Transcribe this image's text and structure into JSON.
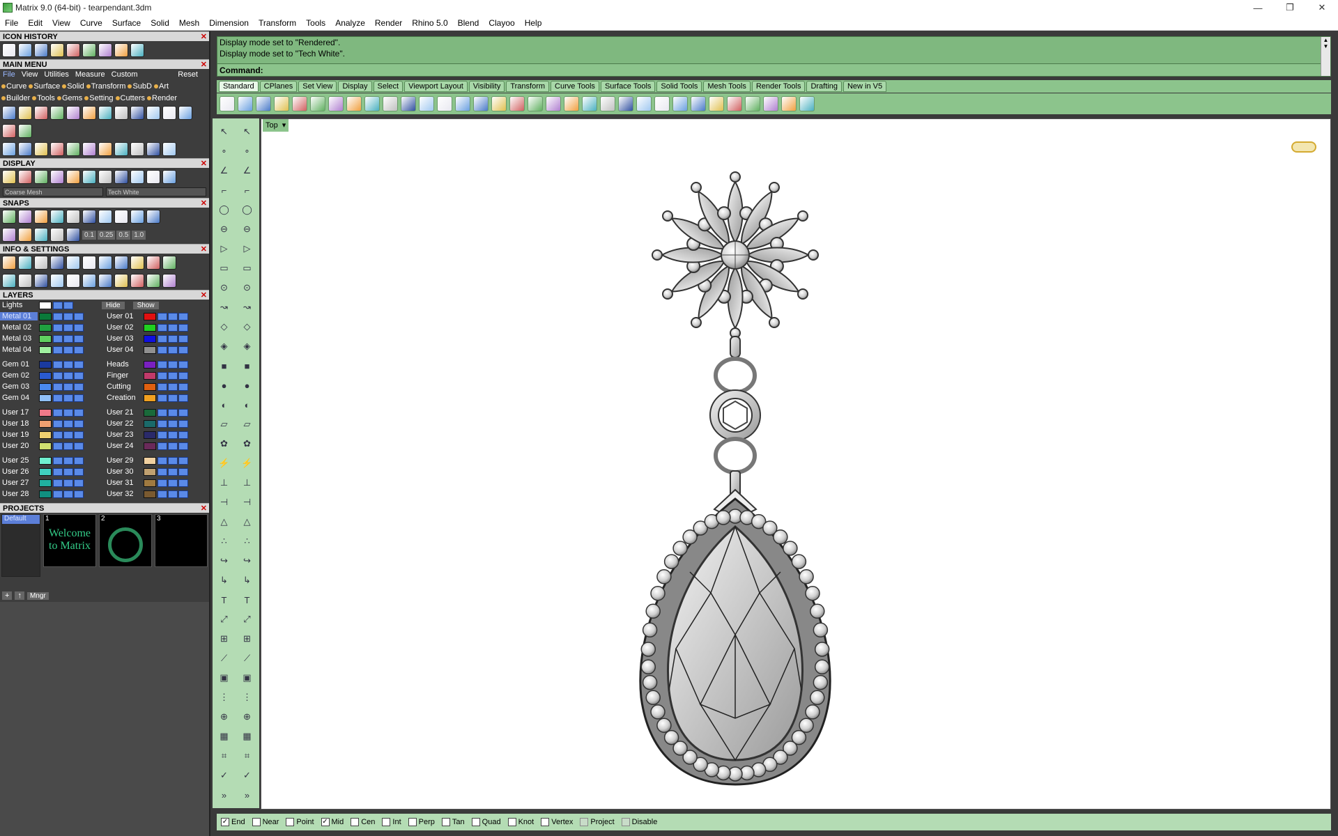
{
  "window": {
    "title": "Matrix 9.0 (64-bit) - tearpendant.3dm",
    "buttons": [
      "—",
      "❐",
      "✕"
    ]
  },
  "menu": [
    "File",
    "Edit",
    "View",
    "Curve",
    "Surface",
    "Solid",
    "Mesh",
    "Dimension",
    "Transform",
    "Tools",
    "Analyze",
    "Render",
    "Rhino 5.0",
    "Blend",
    "Clayoo",
    "Help"
  ],
  "sections": {
    "icon_history": "ICON HISTORY",
    "main_menu": "MAIN MENU",
    "display": "DISPLAY",
    "snaps": "SNAPS",
    "info_settings": "INFO & SETTINGS",
    "layers": "LAYERS",
    "projects": "PROJECTS"
  },
  "main_menu": {
    "tabs": [
      "File",
      "View",
      "Utilities",
      "Measure",
      "Custom"
    ],
    "reset": "Reset",
    "row1": [
      "Curve",
      "Surface",
      "Solid",
      "Transform",
      "SubD",
      "Art"
    ],
    "row2": [
      "Builder",
      "Tools",
      "Gems",
      "Setting",
      "Cutters",
      "Render"
    ]
  },
  "display": {
    "mesh_select": "Coarse Mesh",
    "mode_select": "Tech White"
  },
  "snaps": {
    "values": [
      "0.1",
      "0.25",
      "0.5",
      "1.0"
    ]
  },
  "layers": {
    "lights": "Lights",
    "hide": "Hide",
    "show": "Show",
    "groups": [
      [
        {
          "left": "Metal 01",
          "lcolor": "#0a7a3a",
          "right": "User 01",
          "rcolor": "#e01010",
          "selected": true
        },
        {
          "left": "Metal 02",
          "lcolor": "#20a040",
          "right": "User 02",
          "rcolor": "#20d020"
        },
        {
          "left": "Metal 03",
          "lcolor": "#60d060",
          "right": "User 03",
          "rcolor": "#1010e0"
        },
        {
          "left": "Metal 04",
          "lcolor": "#a0f0a0",
          "right": "User 04",
          "rcolor": "#909090"
        }
      ],
      [
        {
          "left": "Gem 01",
          "lcolor": "#1a3aa0",
          "right": "Heads",
          "rcolor": "#7a20c0"
        },
        {
          "left": "Gem 02",
          "lcolor": "#2a5ad0",
          "right": "Finger",
          "rcolor": "#c03a6a"
        },
        {
          "left": "Gem 03",
          "lcolor": "#4a8af0",
          "right": "Cutting",
          "rcolor": "#e06010"
        },
        {
          "left": "Gem 04",
          "lcolor": "#90c0f8",
          "right": "Creation",
          "rcolor": "#f0a020"
        }
      ],
      [
        {
          "left": "User 17",
          "lcolor": "#f07a8a",
          "right": "User 21",
          "rcolor": "#1a6a3a"
        },
        {
          "left": "User 18",
          "lcolor": "#f0a070",
          "right": "User 22",
          "rcolor": "#1a6a6a"
        },
        {
          "left": "User 19",
          "lcolor": "#f0d070",
          "right": "User 23",
          "rcolor": "#2a2a6a"
        },
        {
          "left": "User 20",
          "lcolor": "#d0e070",
          "right": "User 24",
          "rcolor": "#6a2a5a"
        }
      ],
      [
        {
          "left": "User 25",
          "lcolor": "#70f0d0",
          "right": "User 29",
          "rcolor": "#f0d0a0"
        },
        {
          "left": "User 26",
          "lcolor": "#40d0c0",
          "right": "User 30",
          "rcolor": "#c0a070"
        },
        {
          "left": "User 27",
          "lcolor": "#20b0a0",
          "right": "User 31",
          "rcolor": "#a07a40"
        },
        {
          "left": "User 28",
          "lcolor": "#109080",
          "right": "User 32",
          "rcolor": "#7a5a30"
        }
      ]
    ]
  },
  "projects": {
    "list": [
      "Default"
    ],
    "thumbs": [
      {
        "n": "1",
        "text": "Welcome to Matrix"
      },
      {
        "n": "2",
        "text": ""
      },
      {
        "n": "3",
        "text": ""
      }
    ],
    "mngr": "Mngr"
  },
  "command": {
    "history": [
      "Display mode set to \"Rendered\".",
      "Display mode set to \"Tech White\"."
    ],
    "prompt": "Command:"
  },
  "tabs": [
    "Standard",
    "CPlanes",
    "Set View",
    "Display",
    "Select",
    "Viewport Layout",
    "Visibility",
    "Transform",
    "Curve Tools",
    "Surface Tools",
    "Solid Tools",
    "Mesh Tools",
    "Render Tools",
    "Drafting",
    "New in V5"
  ],
  "viewport": {
    "name": "Top",
    "dropdown": "▾"
  },
  "status": [
    {
      "label": "End",
      "checked": true
    },
    {
      "label": "Near",
      "checked": false
    },
    {
      "label": "Point",
      "checked": false
    },
    {
      "label": "Mid",
      "checked": true
    },
    {
      "label": "Cen",
      "checked": false
    },
    {
      "label": "Int",
      "checked": false
    },
    {
      "label": "Perp",
      "checked": false
    },
    {
      "label": "Tan",
      "checked": false
    },
    {
      "label": "Quad",
      "checked": false
    },
    {
      "label": "Knot",
      "checked": false
    },
    {
      "label": "Vertex",
      "checked": false
    },
    {
      "label": "Project",
      "checked": false,
      "disabled": true
    },
    {
      "label": "Disable",
      "checked": false,
      "disabled": true
    }
  ],
  "vtool_more": "»"
}
